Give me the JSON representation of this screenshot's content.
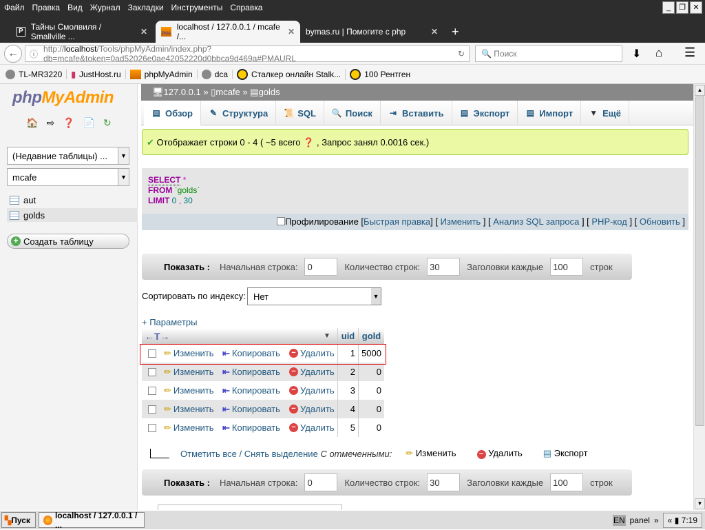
{
  "browser": {
    "menu": [
      "Файл",
      "Правка",
      "Вид",
      "Журнал",
      "Закладки",
      "Инструменты",
      "Справка"
    ],
    "tabs": [
      {
        "title": "Тайны Смолвиля / Smallville ...",
        "icon": "p-favicon"
      },
      {
        "title": "localhost / 127.0.0.1 / mcafe /...",
        "icon": "pma-favicon",
        "active": true
      },
      {
        "title": "bymas.ru | Помогите с php",
        "icon": "none"
      }
    ],
    "url_prefix": "http://",
    "url_host": "localhost",
    "url_rest": "/Tools/phpMyAdmin/index.php?db=mcafe&token=0ad52026e0ae42052220d0bbca9d469a#PMAURL",
    "search_placeholder": "Поиск",
    "bookmarks": [
      "TL-MR3220",
      "JustHost.ru",
      "phpMyAdmin",
      "dca",
      "Сталкер онлайн Stalk...",
      "100 Рентген"
    ]
  },
  "sidebar": {
    "logo_a": "php",
    "logo_b": "MyAdmin",
    "recent": "(Недавние таблицы) ...",
    "db": "mcafe",
    "tables": [
      "aut",
      "golds"
    ],
    "create_table": "Создать таблицу"
  },
  "breadcrumb": {
    "server": "127.0.0.1",
    "db": "mcafe",
    "table": "golds",
    "sep": "»"
  },
  "tabs": [
    "Обзор",
    "Структура",
    "SQL",
    "Поиск",
    "Вставить",
    "Экспорт",
    "Импорт",
    "Ещё"
  ],
  "message": {
    "text1": "Отображает строки 0 - 4 ( ~5 всего",
    "text2": ", Запрос занял 0.0016 сек.)",
    "color": "#ebf8a4"
  },
  "sql": {
    "select": "SELECT",
    "star": "*",
    "from": "FROM",
    "table": "`golds`",
    "limit": "LIMIT",
    "n1": "0",
    "comma": ",",
    "n2": "30"
  },
  "sql_links": {
    "profiling": "Профилирование",
    "inline_edit": "Быстрая правка",
    "edit": "Изменить",
    "explain": "Анализ SQL запроса",
    "php": "PHP-код",
    "refresh": "Обновить"
  },
  "nav": {
    "show": "Показать :",
    "start_label": "Начальная строка:",
    "start": "0",
    "count_label": "Количество строк:",
    "count": "30",
    "headers_label": "Заголовки каждые",
    "headers": "100",
    "rows": "строк"
  },
  "sort": {
    "label": "Сортировать по индексу:",
    "value": "Нет"
  },
  "params": "+ Параметры",
  "grid": {
    "columns": [
      "uid",
      "gold"
    ],
    "actions": {
      "edit": "Изменить",
      "copy": "Копировать",
      "delete": "Удалить"
    },
    "rows": [
      {
        "uid": "1",
        "gold": "5000"
      },
      {
        "uid": "2",
        "gold": "0"
      },
      {
        "uid": "3",
        "gold": "0"
      },
      {
        "uid": "4",
        "gold": "0"
      },
      {
        "uid": "5",
        "gold": "0"
      }
    ]
  },
  "bulk": {
    "check_all": "Отметить все",
    "sep": "/",
    "uncheck": "Снять выделение",
    "with_selected": "С отмеченными:",
    "edit": "Изменить",
    "delete": "Удалить",
    "export": "Экспорт"
  },
  "taskbar": {
    "start": "Пуск",
    "task": "localhost / 127.0.0.1 / ...",
    "lang": "EN",
    "panel": "panel",
    "time": "7:19"
  }
}
